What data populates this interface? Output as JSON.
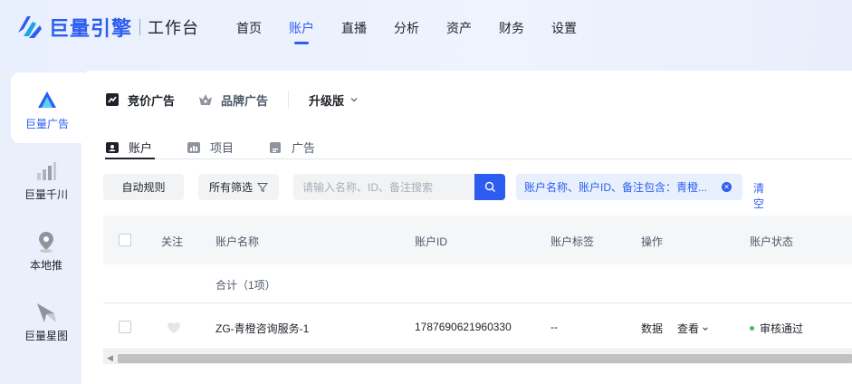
{
  "brand": {
    "name": "巨量引擎",
    "sub": "工作台",
    "accent": "#2c5df0"
  },
  "nav": [
    {
      "label": "首页"
    },
    {
      "label": "账户"
    },
    {
      "label": "直播"
    },
    {
      "label": "分析"
    },
    {
      "label": "资产"
    },
    {
      "label": "财务"
    },
    {
      "label": "设置"
    }
  ],
  "nav_active": "账户",
  "sidebar": {
    "items": [
      {
        "label": "巨量广告",
        "icon": "ocean-engine-ad-icon"
      },
      {
        "label": "巨量千川",
        "icon": "qianchuan-bar-chart-icon"
      },
      {
        "label": "本地推",
        "icon": "local-push-pin-icon"
      },
      {
        "label": "巨量星图",
        "icon": "xingtu-star-icon"
      }
    ]
  },
  "ad_types": {
    "bidding": "竞价广告",
    "brand": "品牌广告",
    "version": "升级版"
  },
  "sub_tabs": [
    {
      "label": "账户",
      "icon": "account-card-icon"
    },
    {
      "label": "项目",
      "icon": "project-chart-icon"
    },
    {
      "label": "广告",
      "icon": "ad-document-icon"
    }
  ],
  "toolbar": {
    "auto_rule": "自动规则",
    "all_filter": "所有筛选",
    "search_placeholder": "请输入名称、ID、备注搜索",
    "filter_tag": "账户名称、账户ID、备注包含：青橙...",
    "clear": "清空"
  },
  "table": {
    "columns": [
      "关注",
      "账户名称",
      "账户ID",
      "账户标签",
      "操作",
      "账户状态"
    ],
    "total_label": "合计（1项）",
    "rows": [
      {
        "name": "ZG-青橙咨询服务-1",
        "id": "1787690621960330",
        "tag": "--",
        "action_data": "数据",
        "action_view": "查看",
        "status": "审核通过"
      }
    ]
  },
  "colors": {
    "primary": "#2c5df0",
    "status_ok": "#3fbd64"
  }
}
